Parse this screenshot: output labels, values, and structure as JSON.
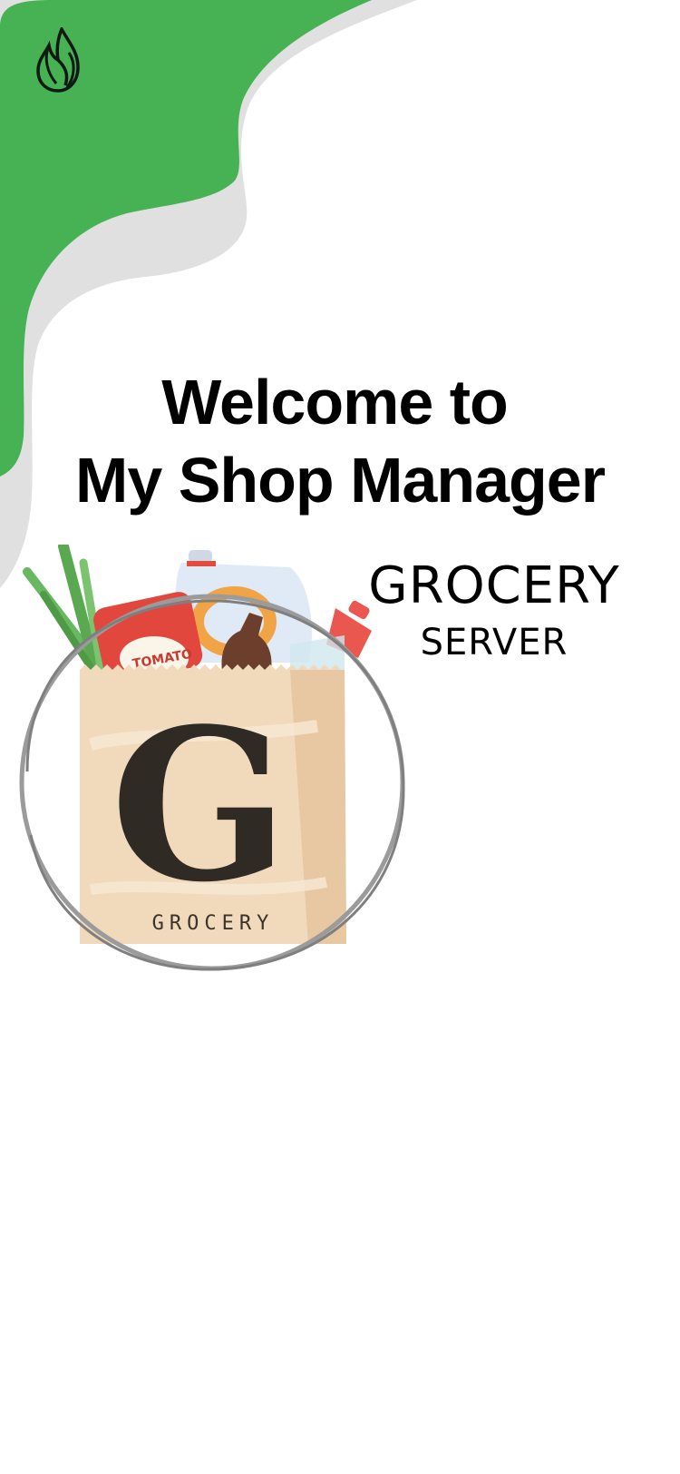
{
  "welcome": {
    "line1": "Welcome to",
    "line2": "My Shop Manager"
  },
  "tagline": {
    "grocery": "GROCERY",
    "server": "SERVER"
  },
  "brand_logo": {
    "letter": "G",
    "word": "GROCERY"
  },
  "icons": {
    "app_logo": "flame-leaf-icon",
    "illustration": "grocery-bag-icon"
  },
  "colors": {
    "accent_green": "#46b253",
    "accent_grey": "#dfe0df",
    "text": "#000000"
  }
}
